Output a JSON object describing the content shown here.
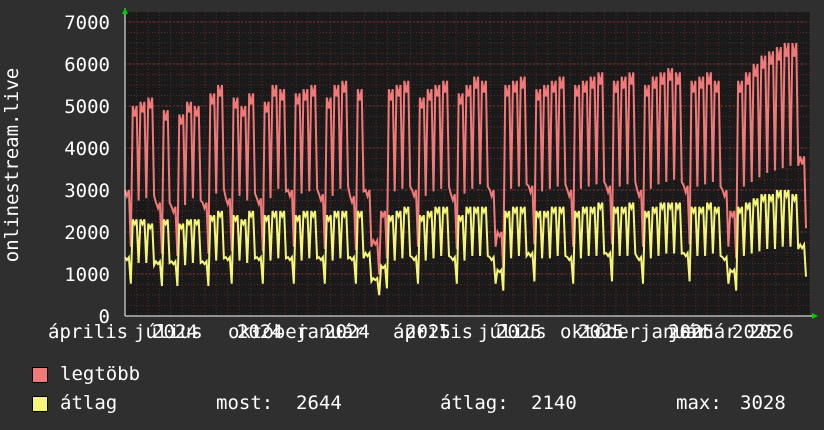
{
  "chart_data": {
    "type": "line",
    "ylabel": "onlinestream.live",
    "ylim": [
      0,
      7000
    ],
    "yticks": [
      "0",
      "1000",
      "2000",
      "3000",
      "4000",
      "5000",
      "6000",
      "7000"
    ],
    "xtick_labels": [
      "április",
      "július",
      "2024",
      "október",
      "2024",
      "január",
      "2024",
      "április",
      "2025",
      "július",
      "2025",
      "október",
      "2025",
      "január",
      "2025",
      "április",
      "2025",
      "január 2026"
    ],
    "x_range": [
      "2024-04",
      "2026-05"
    ],
    "series": [
      {
        "name": "legtöbb",
        "color": "#f07a7a",
        "values_weekly": [
          3000,
          5000,
          5100,
          5200,
          2700,
          4900,
          2600,
          4800,
          5100,
          5000,
          2700,
          5300,
          5500,
          2800,
          5200,
          5000,
          5300,
          2800,
          5100,
          5500,
          5400,
          3000,
          5300,
          5400,
          5500,
          2900,
          5200,
          5500,
          5600,
          2850,
          5400,
          3000,
          1800,
          2500,
          5400,
          5500,
          5600,
          3000,
          5200,
          5400,
          5500,
          5600,
          2900,
          5300,
          5500,
          5700,
          5600,
          3000,
          2000,
          5500,
          5600,
          5700,
          3100,
          5400,
          5500,
          5600,
          5700,
          3000,
          5500,
          5600,
          5700,
          5800,
          3100,
          5600,
          5700,
          5800,
          3000,
          5500,
          5700,
          5800,
          5900,
          5800,
          3100,
          5600,
          5700,
          5800,
          5600,
          3000,
          2500,
          5600,
          5800,
          6000,
          6200,
          6300,
          6400,
          6500,
          6500,
          3800
        ],
        "x_dates": "weekly from 2024-04 to 2026-04"
      },
      {
        "name": "átlag",
        "color": "#f5f57a",
        "values_weekly": [
          1400,
          2300,
          2300,
          2200,
          1300,
          2300,
          1300,
          2200,
          2300,
          2300,
          1300,
          2400,
          2500,
          1400,
          2400,
          2300,
          2500,
          1400,
          2400,
          2500,
          2500,
          1400,
          2400,
          2500,
          2500,
          1400,
          2400,
          2500,
          2500,
          1400,
          2500,
          1500,
          900,
          1200,
          2400,
          2500,
          2600,
          1400,
          2400,
          2500,
          2600,
          2600,
          1400,
          2400,
          2600,
          2600,
          2600,
          1400,
          1100,
          2500,
          2600,
          2600,
          1500,
          2500,
          2500,
          2600,
          2600,
          1400,
          2500,
          2600,
          2600,
          2700,
          1500,
          2600,
          2600,
          2700,
          1400,
          2500,
          2600,
          2700,
          2700,
          2700,
          1500,
          2600,
          2600,
          2700,
          2600,
          1400,
          1100,
          2600,
          2700,
          2800,
          2900,
          2900,
          3000,
          3000,
          2900,
          1700
        ]
      }
    ],
    "grid": true
  },
  "legend": {
    "items": [
      {
        "label": "legtöbb",
        "color": "#f07a7a"
      },
      {
        "label": "átlag",
        "color": "#f5f57a"
      }
    ],
    "stats": {
      "most_label": "most:",
      "most_value": "2644",
      "avg_label": "átlag:",
      "avg_value": "2140",
      "max_label": "max:",
      "max_value": "3028"
    }
  }
}
